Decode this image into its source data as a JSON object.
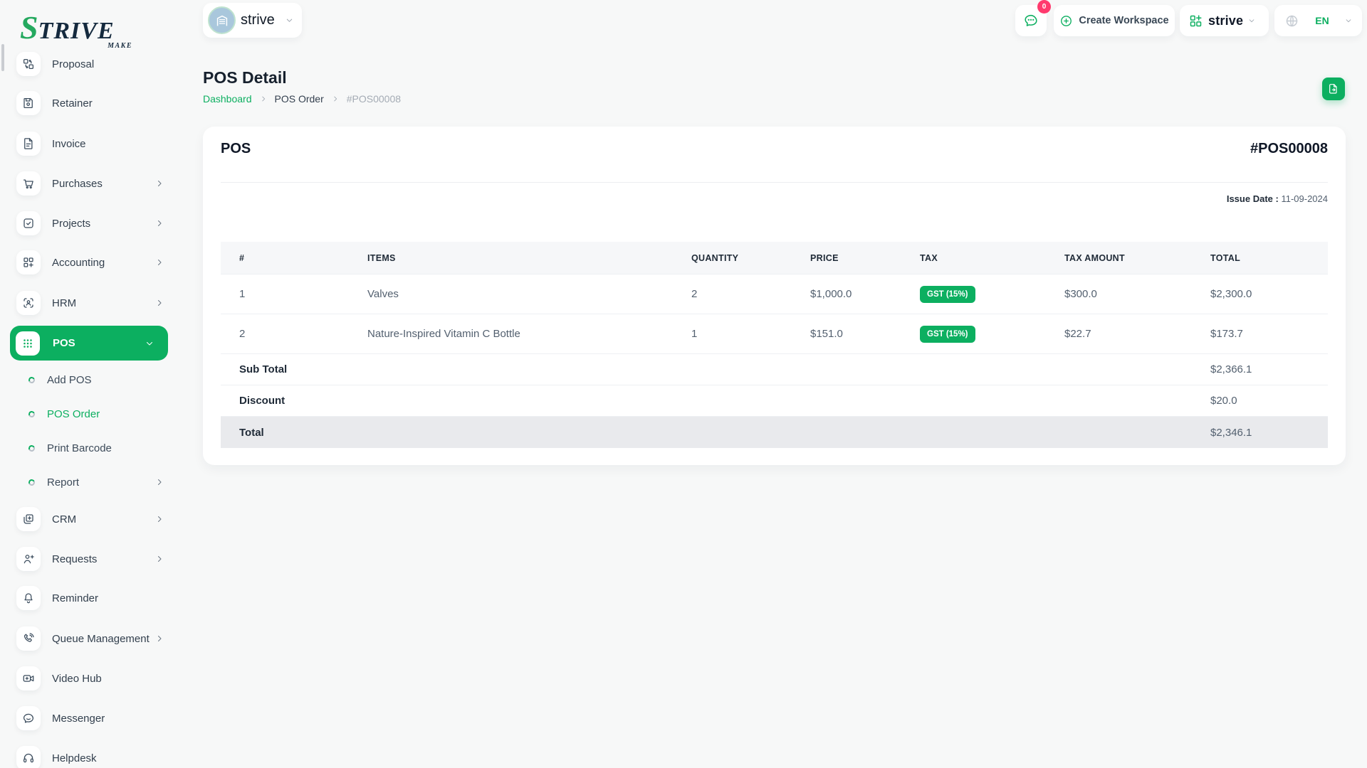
{
  "brand": {
    "name_s": "S",
    "name_rest": "TRIVE",
    "tagline": "MAKE"
  },
  "topbar": {
    "workspace_name": "strive",
    "chat_badge": "0",
    "create_workspace_label": "Create Workspace",
    "app_name": "strive",
    "language": "EN"
  },
  "sidebar": {
    "items": [
      {
        "label": "Proposal",
        "icon": "proposal-icon"
      },
      {
        "label": "Retainer",
        "icon": "retainer-icon"
      },
      {
        "label": "Invoice",
        "icon": "invoice-icon"
      },
      {
        "label": "Purchases",
        "icon": "purchases-icon",
        "expandable": true
      },
      {
        "label": "Projects",
        "icon": "projects-icon",
        "expandable": true
      },
      {
        "label": "Accounting",
        "icon": "accounting-icon",
        "expandable": true
      },
      {
        "label": "HRM",
        "icon": "hrm-icon",
        "expandable": true
      },
      {
        "label": "POS",
        "icon": "pos-icon",
        "expandable": true,
        "active": true,
        "expanded": true
      },
      {
        "label": "Add POS",
        "sub": true
      },
      {
        "label": "POS Order",
        "sub": true,
        "active": true
      },
      {
        "label": "Print Barcode",
        "sub": true
      },
      {
        "label": "Report",
        "sub": true,
        "expandable": true
      },
      {
        "label": "CRM",
        "icon": "crm-icon",
        "expandable": true
      },
      {
        "label": "Requests",
        "icon": "requests-icon",
        "expandable": true
      },
      {
        "label": "Reminder",
        "icon": "reminder-icon"
      },
      {
        "label": "Queue Management",
        "icon": "queue-icon",
        "expandable": true
      },
      {
        "label": "Video Hub",
        "icon": "video-icon"
      },
      {
        "label": "Messenger",
        "icon": "messenger-icon"
      },
      {
        "label": "Helpdesk",
        "icon": "helpdesk-icon"
      }
    ]
  },
  "page": {
    "title": "POS Detail",
    "breadcrumb": {
      "home": "Dashboard",
      "section": "POS Order",
      "current": "#POS00008"
    }
  },
  "pos_card": {
    "title": "POS",
    "number": "#POS00008",
    "issue_date_label": "Issue Date :",
    "issue_date_value": "11-09-2024",
    "table": {
      "headers": {
        "no": "#",
        "items": "ITEMS",
        "quantity": "QUANTITY",
        "price": "PRICE",
        "tax": "TAX",
        "tax_amount": "TAX AMOUNT",
        "total": "TOTAL"
      },
      "rows": [
        {
          "no": "1",
          "item": "Valves",
          "quantity": "2",
          "price": "$1,000.0",
          "tax": "GST (15%)",
          "tax_amount": "$300.0",
          "total": "$2,300.0"
        },
        {
          "no": "2",
          "item": "Nature-Inspired Vitamin C Bottle",
          "quantity": "1",
          "price": "$151.0",
          "tax": "GST (15%)",
          "tax_amount": "$22.7",
          "total": "$173.7"
        }
      ],
      "summary": {
        "sub_total_label": "Sub Total",
        "sub_total": "$2,366.1",
        "discount_label": "Discount",
        "discount": "$20.0",
        "total_label": "Total",
        "total": "$2,346.1"
      }
    }
  },
  "colors": {
    "accent": "#0CAF60",
    "badge": "#FF3A6E"
  }
}
